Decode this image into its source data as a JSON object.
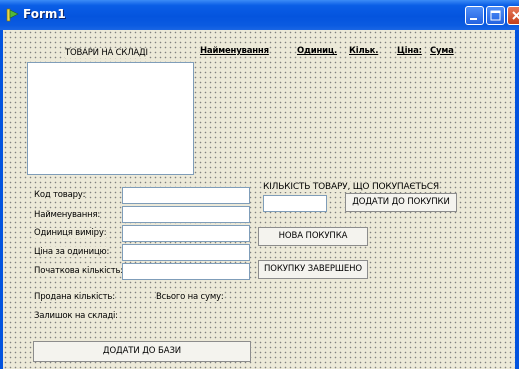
{
  "window": {
    "title": "Form1"
  },
  "stock": {
    "group_label": "ТОВАРИ НА СКЛАДІ"
  },
  "table_header": {
    "columns": [
      "Найменування",
      "Одиниц.",
      "Кільк.",
      "Ціна:",
      "Сума"
    ]
  },
  "fields": {
    "code_label": "Код товару:",
    "name_label": "Найменування:",
    "unit_label": "Одиниця виміру:",
    "price_label": "Ціна за одиницю:",
    "initial_qty_label": "Початкова кількість:",
    "sold_qty_label": "Продана кількість:",
    "total_label": "Всього на суму:",
    "remaining_label": "Залишок на складі:"
  },
  "purchase": {
    "qty_label": "КІЛЬКІСТЬ ТОВАРУ, ЩО ПОКУПАЄТЬСЯ",
    "add_to_purchase": "ДОДАТИ ДО ПОКУПКИ",
    "new_purchase": "НОВА ПОКУПКА",
    "purchase_done": "ПОКУПКУ ЗАВЕРШЕНО"
  },
  "actions": {
    "add_to_db": "ДОДАТИ ДО БАЗИ"
  }
}
